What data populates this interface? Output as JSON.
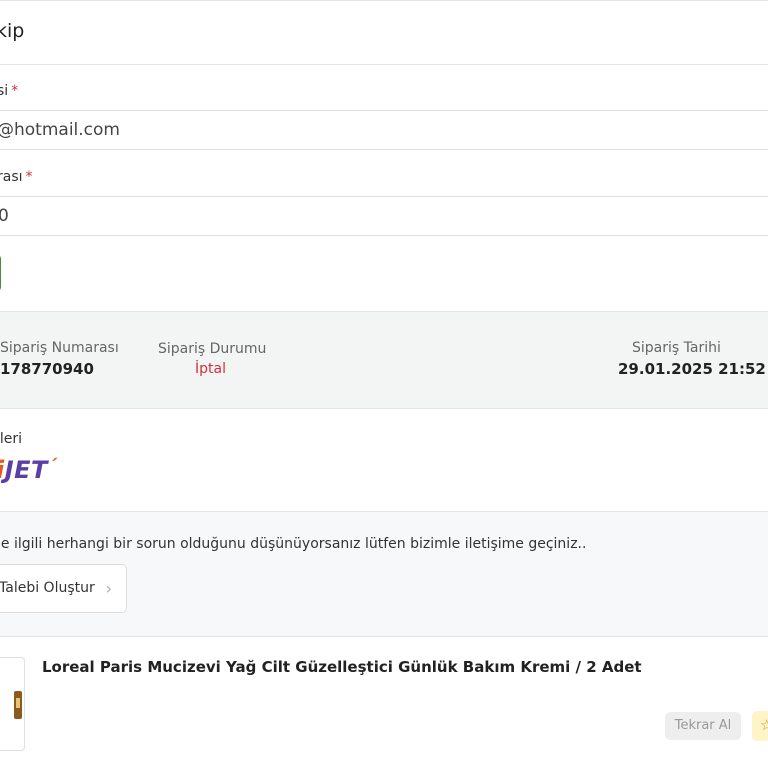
{
  "page": {
    "title": "kip"
  },
  "form": {
    "email_label": "si",
    "email_value": "@hotmail.com",
    "order_no_label": "rası",
    "order_no_value": "0",
    "required_mark": "*"
  },
  "summary": {
    "order_number_label": "Sipariş Numarası",
    "order_number_value": "178770940",
    "status_label": "Sipariş Durumu",
    "status_value": "İptal",
    "date_label": "Sipariş Tarihi",
    "date_value": "29.01.2025 21:52"
  },
  "shipping": {
    "label": "ileri",
    "logo_text_a": "i",
    "logo_text_b": "JET",
    "logo_tick": "´"
  },
  "help": {
    "text": "le ilgili herhangi bir sorun olduğunu düşünüyorsanız lütfen bizimle iletişime geçiniz..",
    "button_label": "Talebi Oluştur"
  },
  "product": {
    "title": "Loreal Paris Mucizevi Yağ Cilt Güzelleştici Günlük Bakım Kremi / 2 Adet",
    "reorder_label": "Tekrar Al"
  },
  "icons": {
    "chevron": "chevron-right-icon",
    "star": "star-icon"
  },
  "colors": {
    "status": "#d0313d",
    "brand_purple": "#5b3fa5",
    "brand_orange": "#e8591f",
    "confirm_green": "#4c8a3a"
  }
}
